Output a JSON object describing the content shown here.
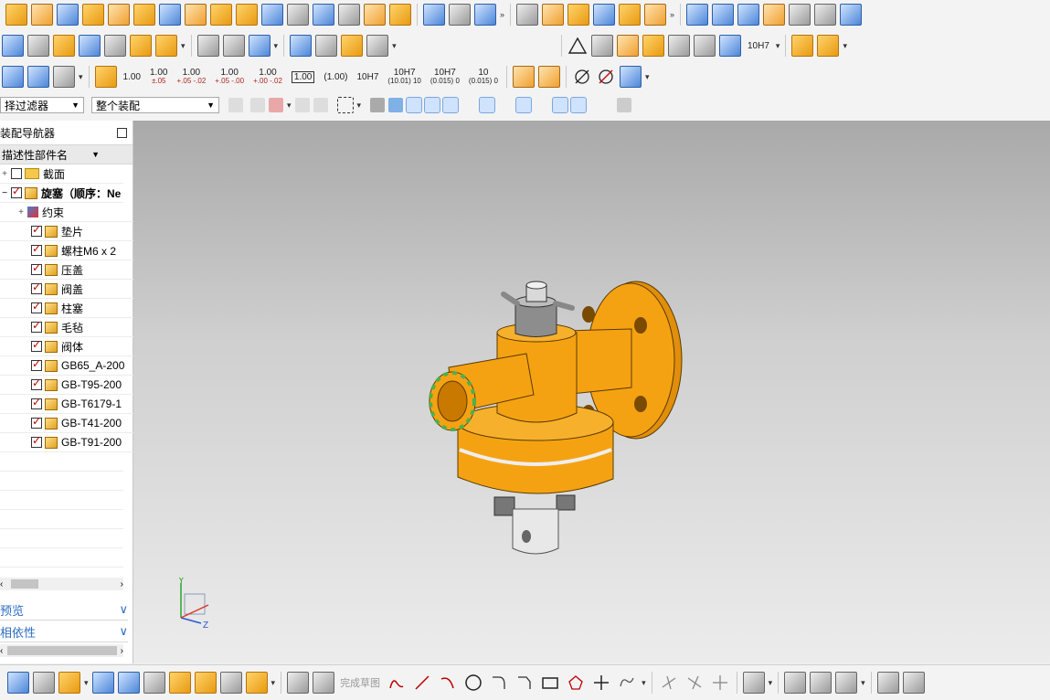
{
  "toolbar": {
    "tolerance_labels": [
      "1.00",
      "1.00",
      "1.00",
      "1.00",
      "1.00",
      "1.00",
      "(1.00)",
      "10H7",
      "10H7",
      "10H7",
      "10"
    ],
    "tolerance_sub": [
      "",
      "±.05",
      "+.05 -.02",
      "+.05 -.00",
      "+.00 -.02",
      "",
      "",
      "",
      "(10.01) 10",
      "(0.015) 0",
      "(0.015) 0"
    ],
    "fit_label": "10H7"
  },
  "filters": {
    "type_filter": "择过滤器",
    "scope_filter": "整个装配"
  },
  "navigator": {
    "title": "装配导航器",
    "column_header": "描述性部件名",
    "section_label": "截面",
    "root_label": "旋塞（顺序：Ne",
    "constraints_label": "约束",
    "parts": [
      "垫片",
      "螺柱M6 x 2",
      "压盖",
      "阀盖",
      "柱塞",
      "毛毡",
      "阀体",
      "GB65_A-200",
      "GB-T95-200",
      "GB-T6179-1",
      "GB-T41-200",
      "GB-T91-200"
    ],
    "preview_label": "预览",
    "dependency_label": "相依性"
  },
  "axes": {
    "y": "Y",
    "z": "Z"
  },
  "bottom": {
    "finish_sketch": "完成草图"
  },
  "colors": {
    "part": "#f5a212",
    "flange_ring": "#4caf50",
    "viewport_top": "#a9a9a9",
    "viewport_bottom": "#ececec"
  }
}
